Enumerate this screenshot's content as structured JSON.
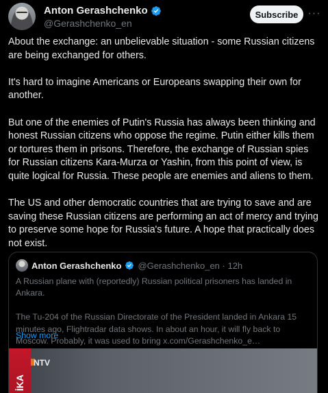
{
  "author": {
    "name": "Anton Gerashchenko",
    "handle": "@Gerashchenko_en",
    "verified_color": "#1d9bf0"
  },
  "actions": {
    "subscribe_label": "Subscribe",
    "more_label": "···"
  },
  "post": {
    "paragraphs": [
      "About the exchange: an unbelievable situation - some Russian citizens are being exchanged for others.",
      "It's hard to imagine Americans or Europeans swapping their own for another.",
      "But one of the enemies of Putin's Russia has always been thinking and honest Russian citizens who oppose the regime. Putin either kills them or tortures them in prisons. Therefore, the exchange of Russian spies for Russian citizens Kara-Murza or Yashin, from this point of view, is quite logical for Russia. These people are enemies and aliens to them.",
      "The US and other democratic countries that are trying to save and are saving these Russian citizens are performing an act of mercy and trying to preserve some hope for Russia's future. A hope that practically does not exist."
    ]
  },
  "quoted": {
    "name": "Anton Gerashchenko",
    "handle_time": "@Gerashchenko_en · 12h",
    "paragraphs": [
      "A Russian plane with (reportedly) Russian political prisoners has landed in Ankara.",
      "The Tu-204 of the Russian Directorate of the President landed in Ankara 15 minutes ago, Flightradar data shows. In about an hour, it will fly back to Moscow. Probably, it was used to bring  x.com/Gerashchenko_e…"
    ],
    "show_more": "Show more",
    "media": {
      "logo_text": "NTV",
      "side_text": "İKA"
    }
  }
}
